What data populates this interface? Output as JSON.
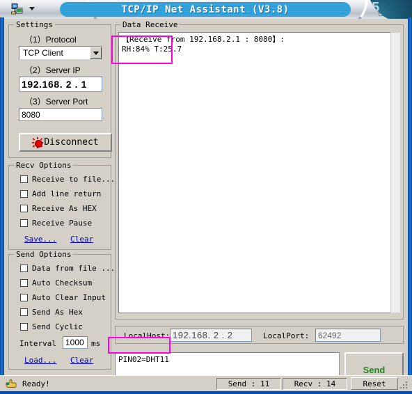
{
  "window": {
    "title": "TCP/IP Net Assistant (V3.8)",
    "app_icon": "network-computers-icon",
    "dropdown_icon": "chevron-down-icon",
    "minimize_label": "minimize-icon",
    "maximize_label": "maximize-icon",
    "overlay_digit": "5"
  },
  "settings": {
    "group_label": "Settings",
    "protocol_label": "（1）Protocol",
    "protocol_value": "TCP Client",
    "protocol_arrow_icon": "chevron-down-icon",
    "server_ip_label": "（2）Server IP",
    "server_ip_value": "192.168. 2 . 1",
    "server_port_label": "（3）Server Port",
    "server_port_value": "8080",
    "connect_button_label": "Disconnect",
    "connect_led_icon": "red-led-icon"
  },
  "recv_options": {
    "group_label": "Recv Options",
    "items": [
      {
        "label": "Receive to file...",
        "checked": false
      },
      {
        "label": "Add line return",
        "checked": false
      },
      {
        "label": "Receive As HEX",
        "checked": false
      },
      {
        "label": "Receive Pause",
        "checked": false
      }
    ],
    "save_link": "Save...",
    "clear_link": "Clear"
  },
  "send_options": {
    "group_label": "Send Options",
    "items": [
      {
        "label": "Data from file ...",
        "checked": false
      },
      {
        "label": "Auto Checksum",
        "checked": false
      },
      {
        "label": "Auto Clear Input",
        "checked": false
      },
      {
        "label": "Send As Hex",
        "checked": false
      },
      {
        "label": "Send Cyclic",
        "checked": false
      }
    ],
    "interval_label": "Interval",
    "interval_value": "1000",
    "interval_unit": "ms",
    "load_link": "Load...",
    "clear_link": "Clear"
  },
  "data_receive": {
    "group_label": "Data Receive",
    "lines": [
      "【Receive from 192.168.2.1 : 8080】:",
      "RH:84% T:25.7"
    ],
    "text": "【Receive from 192.168.2.1 : 8080】:\nRH:84% T:25.7"
  },
  "connection": {
    "localhost_label": "LocalHost:",
    "localhost_value": "192.168. 2 . 2",
    "localport_label": "LocalPort:",
    "localport_value": "62492"
  },
  "send_area": {
    "input_value": "PIN02=DHT11",
    "send_button_label": "Send",
    "send_button_color": "#1a8a1a"
  },
  "statusbar": {
    "ready_icon": "pointing-hand-icon",
    "ready_text": "Ready!",
    "send_count": "Send : 11",
    "recv_count": "Recv : 14",
    "reset_label": "Reset",
    "grip_icon": "resize-grip-icon"
  },
  "highlights": {
    "accent_color": "#ff00e0",
    "recv_box": "RH:84% T:25.7",
    "send_box": "PIN02=DHT11"
  }
}
